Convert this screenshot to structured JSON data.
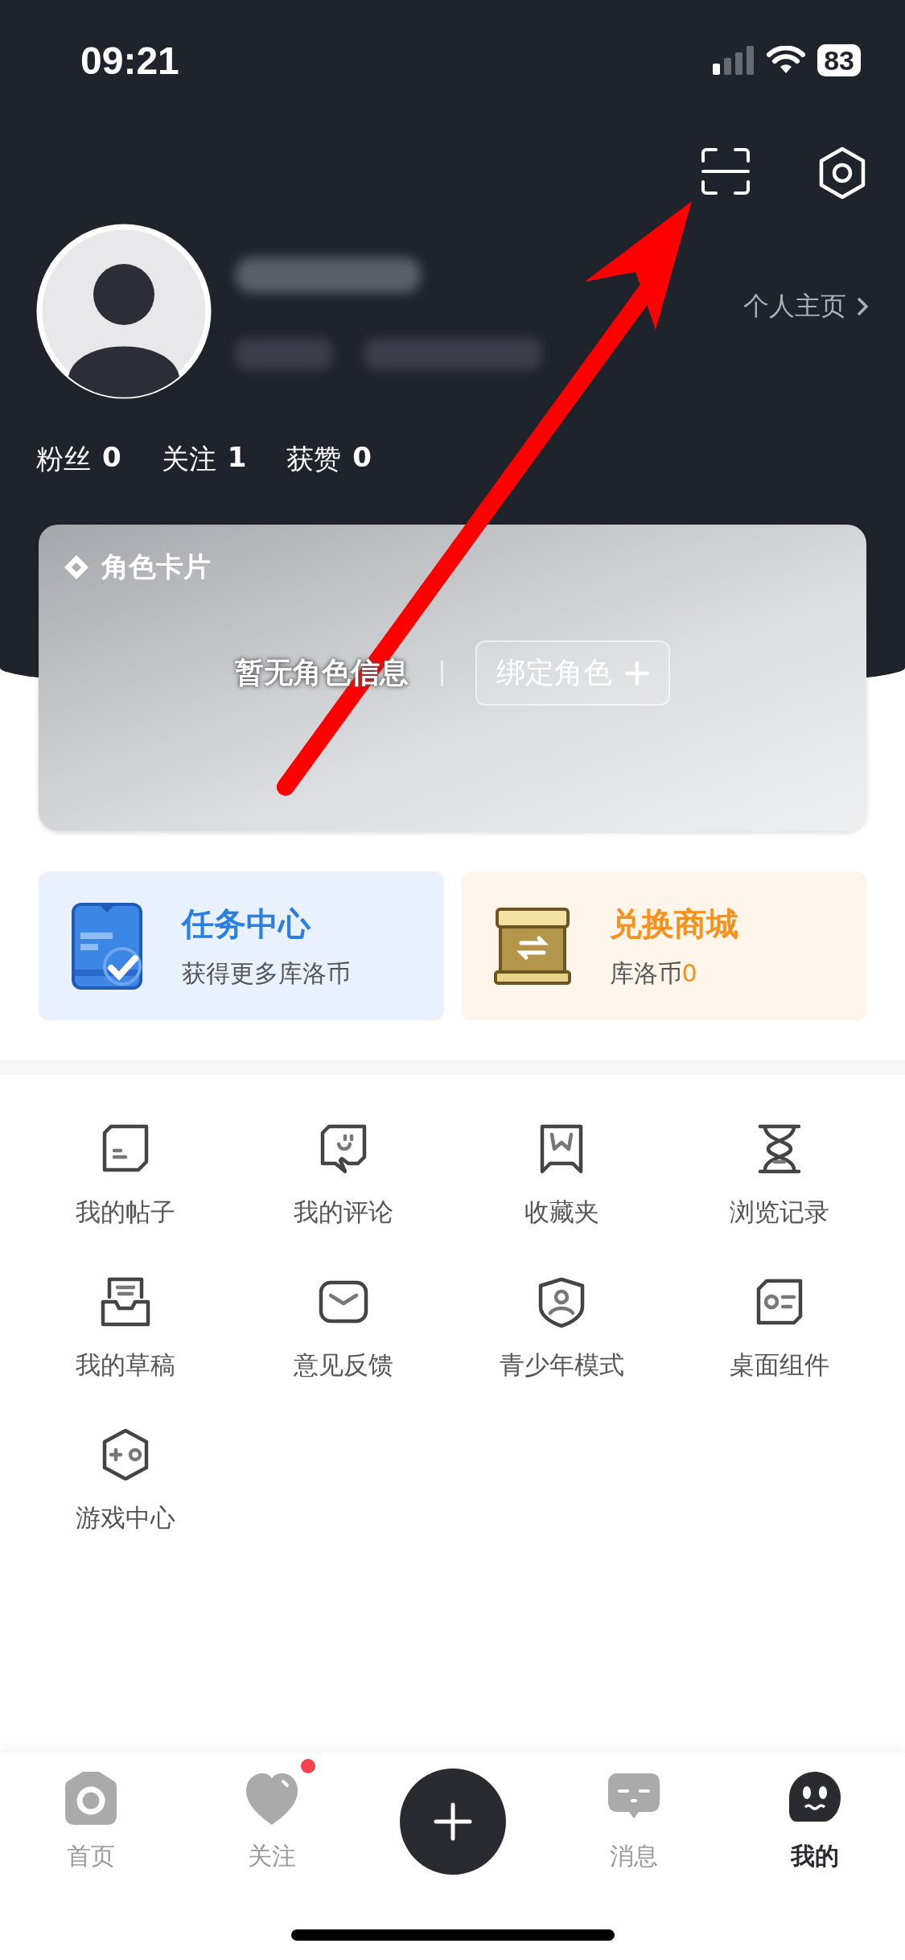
{
  "status_bar": {
    "time": "09:21",
    "battery": "83"
  },
  "profile": {
    "homepage_link": "个人主页",
    "stats": [
      {
        "label": "粉丝",
        "value": "0"
      },
      {
        "label": "关注",
        "value": "1"
      },
      {
        "label": "获赞",
        "value": "0"
      }
    ]
  },
  "role_card": {
    "title": "角色卡片",
    "empty_text": "暂无角色信息",
    "bind_button": "绑定角色"
  },
  "promo_cards": [
    {
      "title": "任务中心",
      "subtitle": "获得更多库洛币",
      "color": "#2b7fe3"
    },
    {
      "title": "兑换商城",
      "subtitle": "库洛币",
      "subtitle_value": "0",
      "color": "#f5911d"
    }
  ],
  "menu_items": [
    {
      "label": "我的帖子"
    },
    {
      "label": "我的评论"
    },
    {
      "label": "收藏夹"
    },
    {
      "label": "浏览记录"
    },
    {
      "label": "我的草稿"
    },
    {
      "label": "意见反馈"
    },
    {
      "label": "青少年模式"
    },
    {
      "label": "桌面组件"
    },
    {
      "label": "游戏中心"
    }
  ],
  "tab_bar": [
    {
      "label": "首页",
      "selected": false,
      "dot": false
    },
    {
      "label": "关注",
      "selected": false,
      "dot": true
    },
    {
      "kind": "add"
    },
    {
      "label": "消息",
      "selected": false,
      "dot": false
    },
    {
      "label": "我的",
      "selected": true,
      "dot": false
    }
  ]
}
